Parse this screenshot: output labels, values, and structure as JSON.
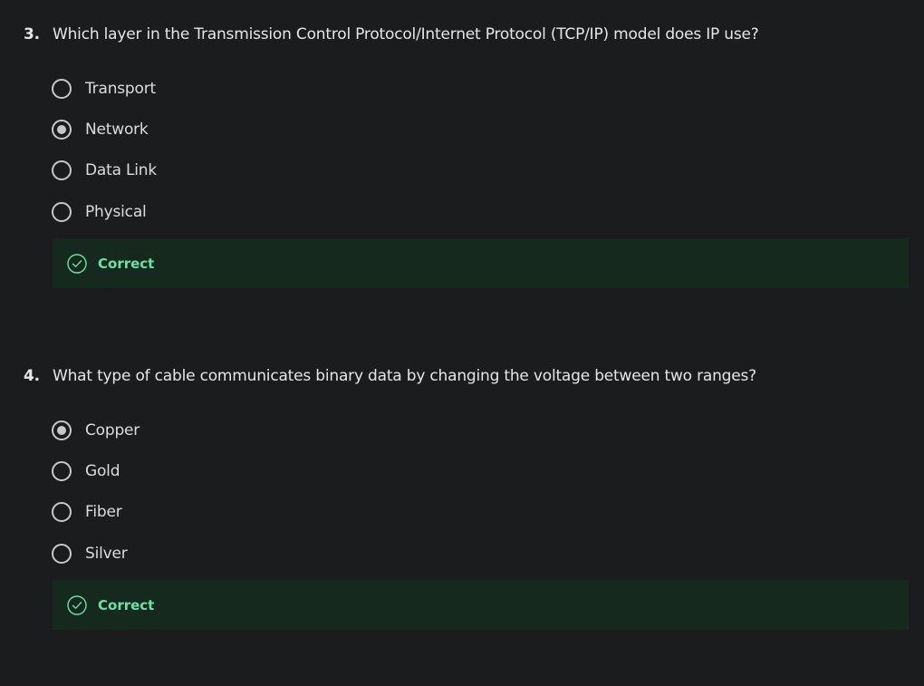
{
  "questions": [
    {
      "number": "3.",
      "text": "Which layer in the Transmission Control Protocol/Internet Protocol (TCP/IP) model does IP use?",
      "options": [
        {
          "label": "Transport",
          "selected": false
        },
        {
          "label": "Network",
          "selected": true
        },
        {
          "label": "Data Link",
          "selected": false
        },
        {
          "label": "Physical",
          "selected": false
        }
      ],
      "feedback": "Correct"
    },
    {
      "number": "4.",
      "text": "What type of cable communicates binary data by changing the voltage between two ranges?",
      "options": [
        {
          "label": "Copper",
          "selected": true
        },
        {
          "label": "Gold",
          "selected": false
        },
        {
          "label": "Fiber",
          "selected": false
        },
        {
          "label": "Silver",
          "selected": false
        }
      ],
      "feedback": "Correct"
    }
  ],
  "colors": {
    "background": "#1b1c1e",
    "feedback_bg": "#16291f",
    "correct_green": "#6fe0a3",
    "radio": "#c8c8c8"
  },
  "icons": {
    "feedback": "check-circle-icon"
  }
}
